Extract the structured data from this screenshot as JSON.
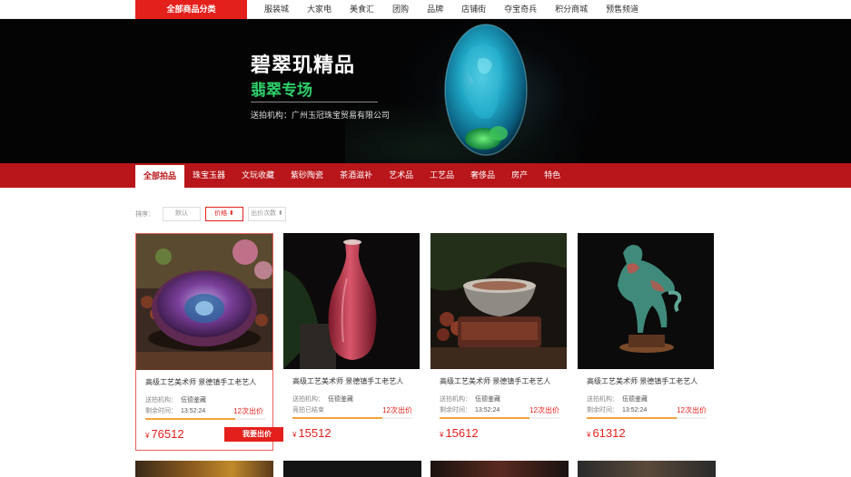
{
  "nav": {
    "all_categories": "全部商品分类",
    "items": [
      {
        "label": "服装城"
      },
      {
        "label": "大家电"
      },
      {
        "label": "美食汇"
      },
      {
        "label": "团购"
      },
      {
        "label": "品牌"
      },
      {
        "label": "店铺街"
      },
      {
        "label": "夺宝奇兵"
      },
      {
        "label": "积分商城"
      },
      {
        "label": "预售频道"
      }
    ]
  },
  "banner": {
    "title": "碧翠玑精品",
    "subtitle": "翡翠专场",
    "org": "送拍机构：广州玉冠珠宝贸易有限公司"
  },
  "categories": [
    {
      "label": "全部拍品",
      "active": true
    },
    {
      "label": "珠宝玉器"
    },
    {
      "label": "文玩收藏"
    },
    {
      "label": "紫砂陶瓷"
    },
    {
      "label": "茶酒滋补"
    },
    {
      "label": "艺术品"
    },
    {
      "label": "工艺品"
    },
    {
      "label": "奢侈品"
    },
    {
      "label": "房产"
    },
    {
      "label": "特色"
    }
  ],
  "sort": {
    "label": "排序：",
    "options": [
      {
        "label": "默认"
      },
      {
        "label": "价格 ⬍"
      },
      {
        "label": "出价次数 ⬍"
      }
    ]
  },
  "lots": [
    {
      "title": "高级工艺美术师 景德镇手工老艺人",
      "org_label": "送拍机构：",
      "org": "伍德鉴藏",
      "time_label": "剩余时间：",
      "time": "13:52:24",
      "bids": "12次出价",
      "currency": "¥",
      "price": "76512",
      "progress": 0.75,
      "bid_button": "我要出价"
    },
    {
      "title": "高级工艺美术师 景德镇手工老艺人",
      "org_label": "送拍机构：",
      "org": "伍德鉴藏",
      "time_label": "竞拍已结束",
      "time": "",
      "bids": "12次出价",
      "currency": "¥",
      "price": "15512",
      "progress": 0.75
    },
    {
      "title": "高级工艺美术师 景德镇手工老艺人",
      "org_label": "送拍机构：",
      "org": "伍德鉴藏",
      "time_label": "剩余时间：",
      "time": "13:52:24",
      "bids": "12次出价",
      "currency": "¥",
      "price": "15612",
      "progress": 0.75
    },
    {
      "title": "高级工艺美术师 景德镇手工老艺人",
      "org_label": "送拍机构：",
      "org": "伍德鉴藏",
      "time_label": "剩余时间：",
      "time": "13:52:24",
      "bids": "12次出价",
      "currency": "¥",
      "price": "61312",
      "progress": 0.75
    }
  ],
  "colors": {
    "brand_red": "#e4201c",
    "category_bar": "#b8161a",
    "progress": "#f4a23a"
  }
}
